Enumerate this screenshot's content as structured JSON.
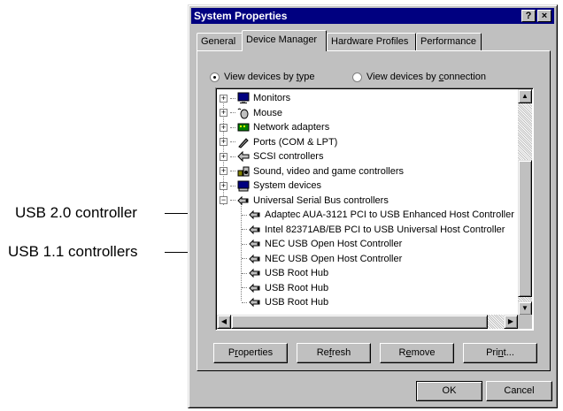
{
  "callouts": {
    "usb20": "USB 2.0 controller",
    "usb11": "USB 1.1 controllers"
  },
  "window": {
    "title": "System Properties",
    "help_btn": "?",
    "close_btn": "×"
  },
  "tabs": [
    {
      "label": "General"
    },
    {
      "label": "Device Manager"
    },
    {
      "label": "Hardware Profiles"
    },
    {
      "label": "Performance"
    }
  ],
  "view": {
    "by_type_prefix": "View devices by ",
    "by_type_key": "t",
    "by_type_suffix": "ype",
    "by_conn_prefix": "View devices by ",
    "by_conn_key": "c",
    "by_conn_suffix": "onnection",
    "selected": "by_type"
  },
  "tree": {
    "categories": [
      {
        "label": "Monitors",
        "expander": "+",
        "icon": "monitor-icon"
      },
      {
        "label": "Mouse",
        "expander": "+",
        "icon": "mouse-icon"
      },
      {
        "label": "Network adapters",
        "expander": "+",
        "icon": "network-icon"
      },
      {
        "label": "Ports (COM & LPT)",
        "expander": "+",
        "icon": "port-icon"
      },
      {
        "label": "SCSI controllers",
        "expander": "+",
        "icon": "scsi-icon"
      },
      {
        "label": "Sound, video and game controllers",
        "expander": "+",
        "icon": "sound-icon"
      },
      {
        "label": "System devices",
        "expander": "+",
        "icon": "system-icon"
      },
      {
        "label": "Universal Serial Bus controllers",
        "expander": "−",
        "icon": "usb-icon"
      }
    ],
    "usb_children": [
      "Adaptec AUA-3121 PCI to USB Enhanced Host Controller",
      "Intel 82371AB/EB PCI to USB Universal Host Controller",
      "NEC USB Open Host Controller",
      "NEC USB Open Host Controller",
      "USB Root Hub",
      "USB Root Hub",
      "USB Root Hub"
    ]
  },
  "buttons": {
    "properties_pre": "P",
    "properties_key": "r",
    "properties_post": "operties",
    "refresh_pre": "Re",
    "refresh_key": "f",
    "refresh_post": "resh",
    "remove_pre": "R",
    "remove_key": "e",
    "remove_post": "move",
    "print_pre": "Pri",
    "print_key": "n",
    "print_post": "t...",
    "ok": "OK",
    "cancel": "Cancel"
  },
  "colors": {
    "titlebar": "#000080",
    "face": "#c0c0c0"
  }
}
